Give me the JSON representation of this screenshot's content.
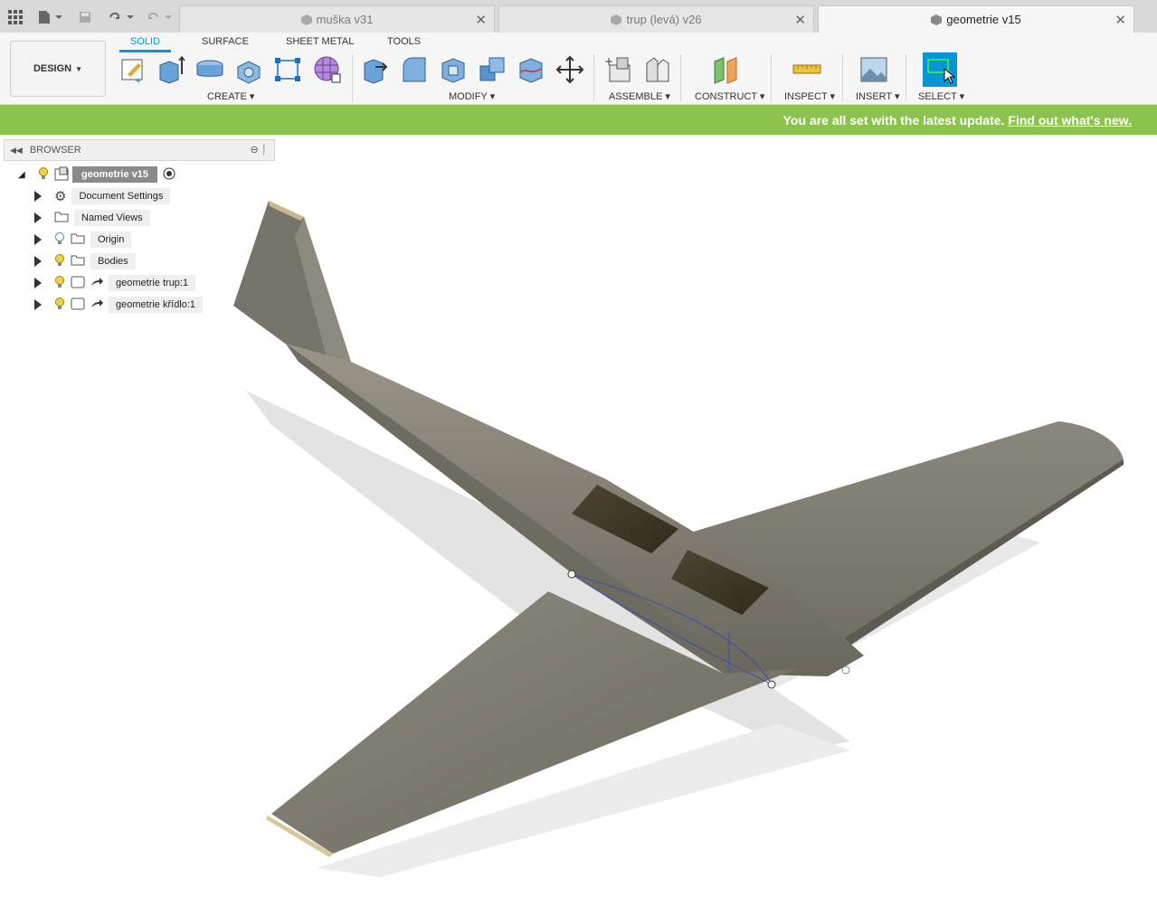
{
  "tabs": [
    {
      "label": "muška v31",
      "active": false
    },
    {
      "label": "trup (levá) v26",
      "active": false
    },
    {
      "label": "geometrie v15",
      "active": true
    }
  ],
  "toolbar": {
    "workspace_label": "DESIGN",
    "ribbon_tabs": [
      "SOLID",
      "SURFACE",
      "SHEET METAL",
      "TOOLS"
    ],
    "groups": {
      "create": "CREATE",
      "modify": "MODIFY",
      "assemble": "ASSEMBLE",
      "construct": "CONSTRUCT",
      "inspect": "INSPECT",
      "insert": "INSERT",
      "select": "SELECT"
    }
  },
  "banner": {
    "message": "You are all set with the latest update.",
    "link": "Find out what's new."
  },
  "browser": {
    "title": "BROWSER",
    "root": "geometrie v15",
    "items": [
      {
        "label": "Document Settings",
        "icon": "gear-icon"
      },
      {
        "label": "Named Views",
        "icon": "folder-icon"
      },
      {
        "label": "Origin",
        "icon": "folder-icon"
      },
      {
        "label": "Bodies",
        "icon": "folder-icon"
      },
      {
        "label": "geometrie trup:1",
        "icon": "component-link-icon"
      },
      {
        "label": "geometrie křídlo:1",
        "icon": "component-link-icon"
      }
    ]
  },
  "colors": {
    "accent": "#0696d7",
    "banner": "#8cc34b",
    "model": "#7d7a6e"
  }
}
